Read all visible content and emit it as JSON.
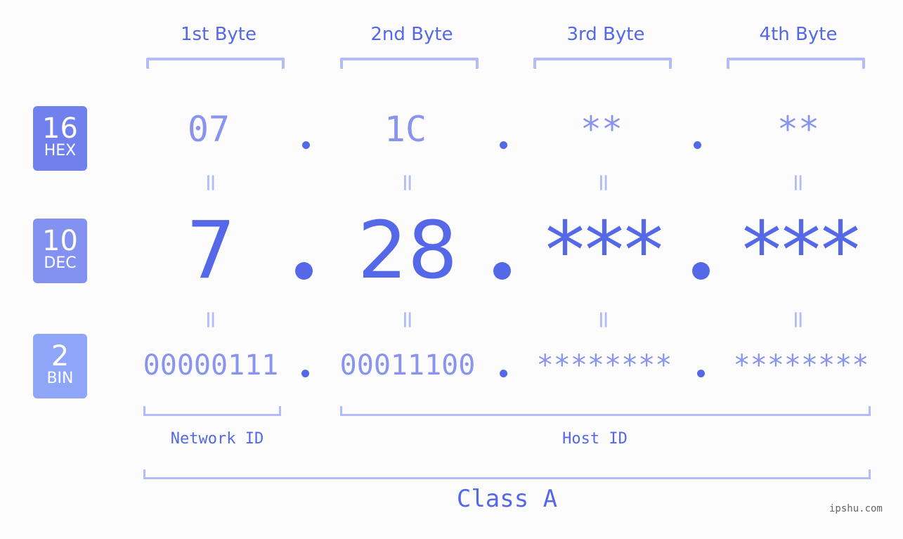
{
  "bytes": {
    "headers": [
      "1st Byte",
      "2nd Byte",
      "3rd Byte",
      "4th Byte"
    ],
    "hex": [
      "07",
      "1C",
      "**",
      "**"
    ],
    "dec": [
      "7",
      "28",
      "***",
      "***"
    ],
    "bin": [
      "00000111",
      "00011100",
      "********",
      "********"
    ],
    "separator": ".",
    "equals": "="
  },
  "badges": [
    {
      "base": "16",
      "name": "HEX",
      "color": "#7080ec"
    },
    {
      "base": "10",
      "name": "DEC",
      "color": "#8391f1"
    },
    {
      "base": "2",
      "name": "BIN",
      "color": "#8fa5f8"
    }
  ],
  "labels": {
    "network_id": "Network ID",
    "host_id": "Host ID",
    "class": "Class A"
  },
  "watermark": "ipshu.com",
  "colors": {
    "primary": "#5468e8",
    "secondary": "#8a94ee",
    "bracket": "#b3bcf8",
    "background": "#fbfcfb"
  }
}
